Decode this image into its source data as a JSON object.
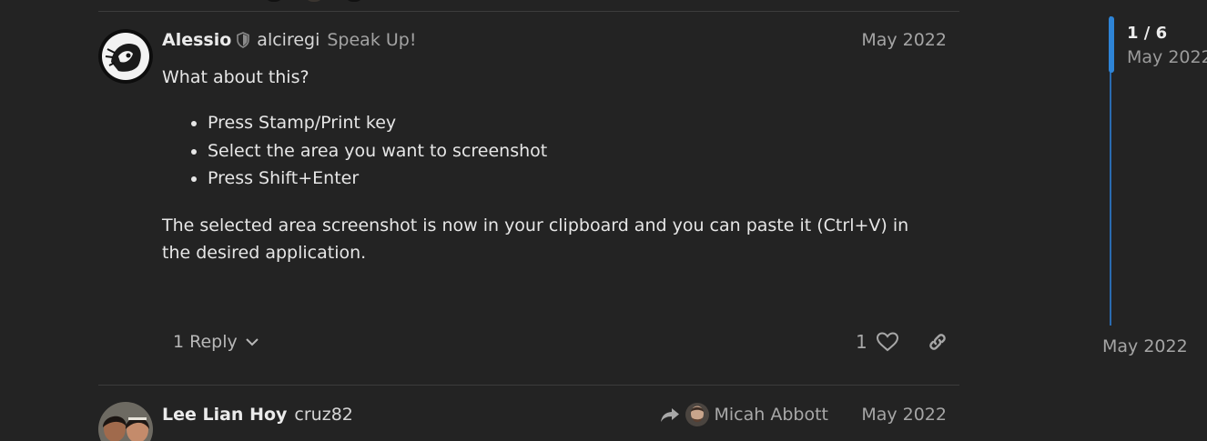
{
  "post1": {
    "full_name": "Alessio",
    "username": "alciregi",
    "user_title": "Speak Up!",
    "date": "May 2022",
    "intro": "What about this?",
    "steps": [
      "Press Stamp/Print key",
      "Select the area you want to screenshot",
      "Press Shift+Enter"
    ],
    "conclusion": "The selected area screenshot is now in your clipboard and you can paste it (Ctrl+V) in the desired application.",
    "reply_button": "1 Reply",
    "like_count": "1",
    "icons": {
      "moderator": "shield-icon",
      "expand": "chevron-down-icon",
      "like": "heart-icon",
      "share": "link-icon"
    }
  },
  "post2": {
    "full_name": "Lee Lian Hoy",
    "username": "cruz82",
    "reply_to_name": "Micah Abbott",
    "date": "May 2022",
    "icons": {
      "reply_to": "share-arrow-icon"
    }
  },
  "timeline": {
    "position": "1 / 6",
    "top_date": "May 2022",
    "bottom_date": "May 2022"
  }
}
